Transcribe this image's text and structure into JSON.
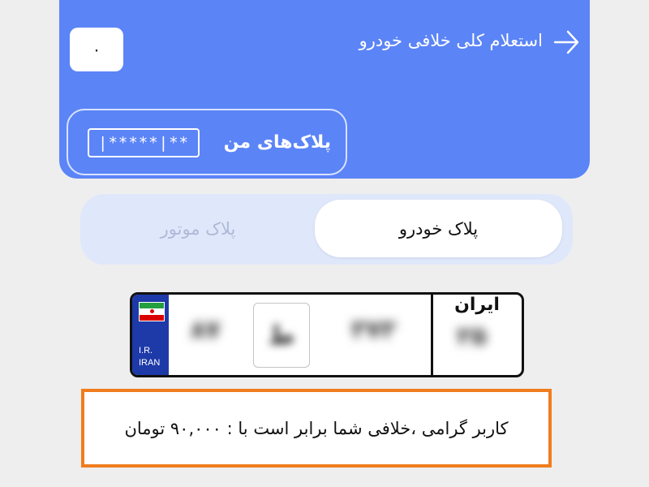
{
  "header": {
    "title": "استعلام کلی خلافی خودرو",
    "count": "۰",
    "back_icon": "arrow-right-icon",
    "background_color": "#5b84f7"
  },
  "my_plates": {
    "label": "پلاک‌های من",
    "masked_plate": "|*****|**"
  },
  "plate_type_tabs": [
    {
      "label": "پلاک خودرو",
      "active": true
    },
    {
      "label": "پلاک موتور",
      "active": false
    }
  ],
  "plate": {
    "country_code": "I.R.",
    "country_name": "IRAN",
    "flag_icon": "iran-flag-icon",
    "region_label": "ایران",
    "two_digits": "۸۷",
    "letter": "ط",
    "three_digits": "۳۷۳",
    "region_code": "۲۵"
  },
  "result": {
    "message": "کاربر گرامی ،خلافی شما برابر است با : ۹۰,۰۰۰ تومان",
    "highlight_color": "#f07d1e"
  }
}
